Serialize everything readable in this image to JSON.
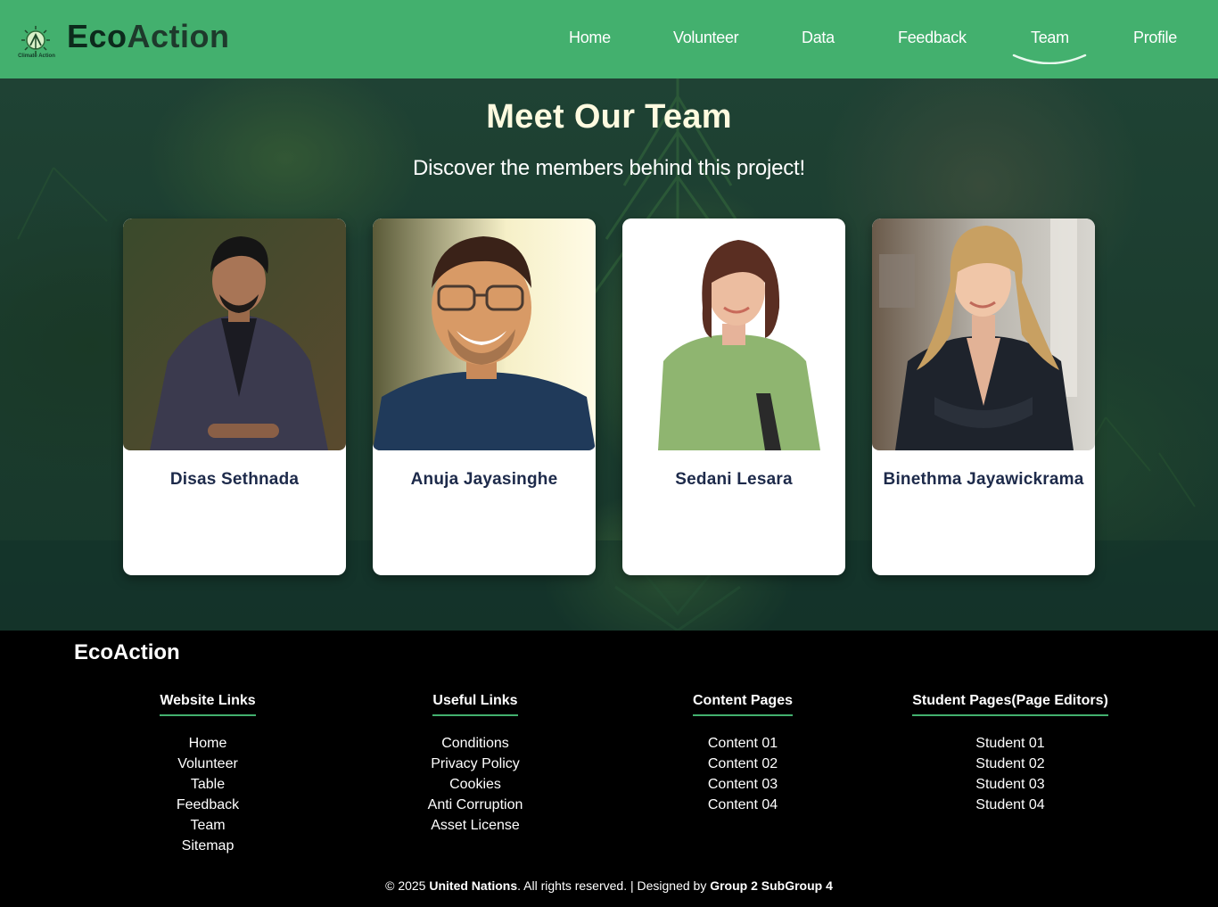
{
  "header": {
    "brand_part1": "Eco",
    "brand_part2": "Action",
    "logo_caption": "Climate Action",
    "nav": [
      {
        "label": "Home"
      },
      {
        "label": "Volunteer"
      },
      {
        "label": "Data"
      },
      {
        "label": "Feedback"
      },
      {
        "label": "Team",
        "active": true
      },
      {
        "label": "Profile"
      }
    ],
    "accent_color": "#43b06e"
  },
  "hero": {
    "title": "Meet Our Team",
    "subtitle": "Discover the members behind this project!"
  },
  "team": [
    {
      "name": "Disas Sethnada"
    },
    {
      "name": "Anuja Jayasinghe"
    },
    {
      "name": "Sedani Lesara"
    },
    {
      "name": "Binethma Jayawickrama"
    }
  ],
  "footer": {
    "brand": "EcoAction",
    "columns": [
      {
        "title": "Website Links",
        "links": [
          "Home",
          "Volunteer",
          "Table",
          "Feedback",
          "Team",
          "Sitemap"
        ]
      },
      {
        "title": "Useful Links",
        "links": [
          "Conditions",
          "Privacy Policy",
          "Cookies",
          "Anti Corruption",
          "Asset License"
        ]
      },
      {
        "title": "Content Pages",
        "links": [
          "Content 01",
          "Content 02",
          "Content 03",
          "Content 04"
        ]
      },
      {
        "title": "Student Pages(Page Editors)",
        "links": [
          "Student 01",
          "Student 02",
          "Student 03",
          "Student 04"
        ]
      }
    ],
    "copyright": {
      "prefix": "© 2025 ",
      "org": "United Nations",
      "middle": ". All rights reserved. | Designed by ",
      "designer": "Group 2 SubGroup 4"
    }
  }
}
